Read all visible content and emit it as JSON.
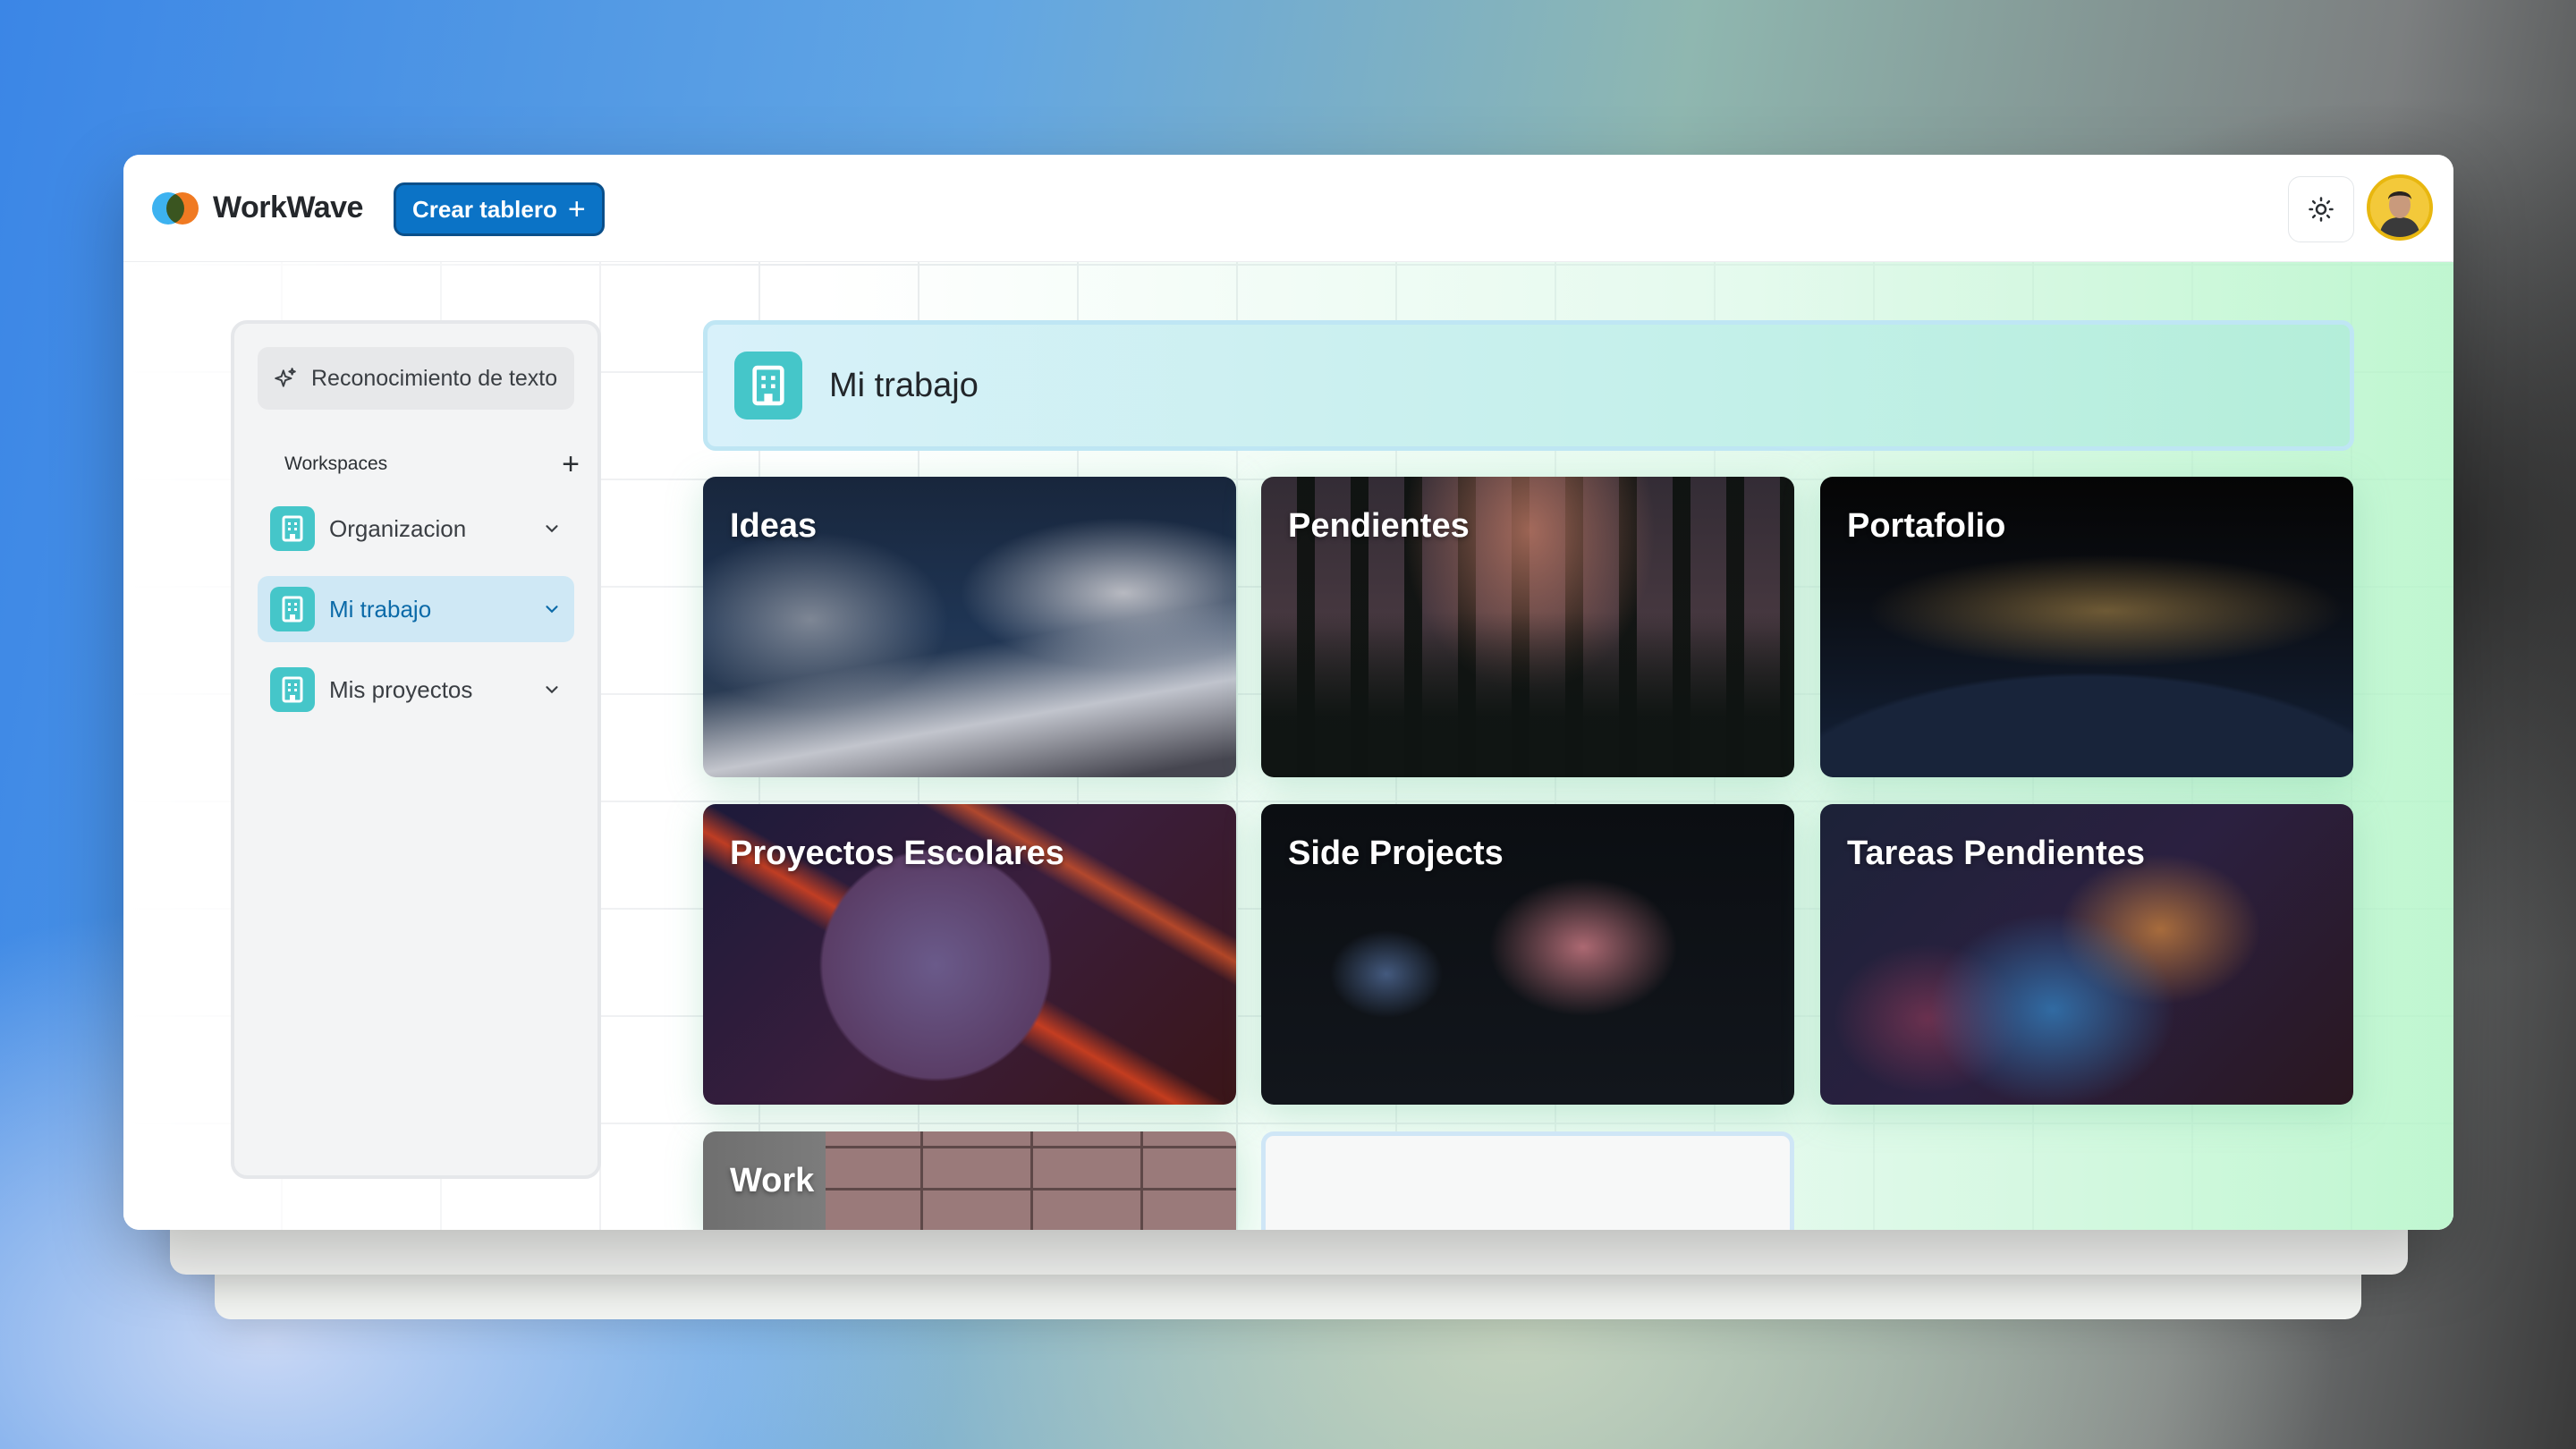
{
  "app": {
    "brand": "WorkWave",
    "create_board_label": "Crear tablero",
    "theme_toggle_icon": "sun-icon"
  },
  "colors": {
    "accent": "#0b73c6",
    "workspace_icon": "#45c6c9",
    "active_item_bg": "#cfe8f5",
    "active_item_text": "#0b6aa8"
  },
  "sidebar": {
    "ocr_label": "Reconocimiento de texto",
    "workspaces_title": "Workspaces",
    "items": [
      {
        "label": "Organizacion",
        "active": false
      },
      {
        "label": "Mi trabajo",
        "active": true
      },
      {
        "label": "Mis proyectos",
        "active": false
      }
    ]
  },
  "main": {
    "title": "Mi trabajo",
    "boards": [
      {
        "title": "Ideas"
      },
      {
        "title": "Pendientes"
      },
      {
        "title": "Portafolio"
      },
      {
        "title": "Proyectos Escolares"
      },
      {
        "title": "Side Projects"
      },
      {
        "title": "Tareas Pendientes"
      },
      {
        "title": "Work"
      }
    ]
  }
}
